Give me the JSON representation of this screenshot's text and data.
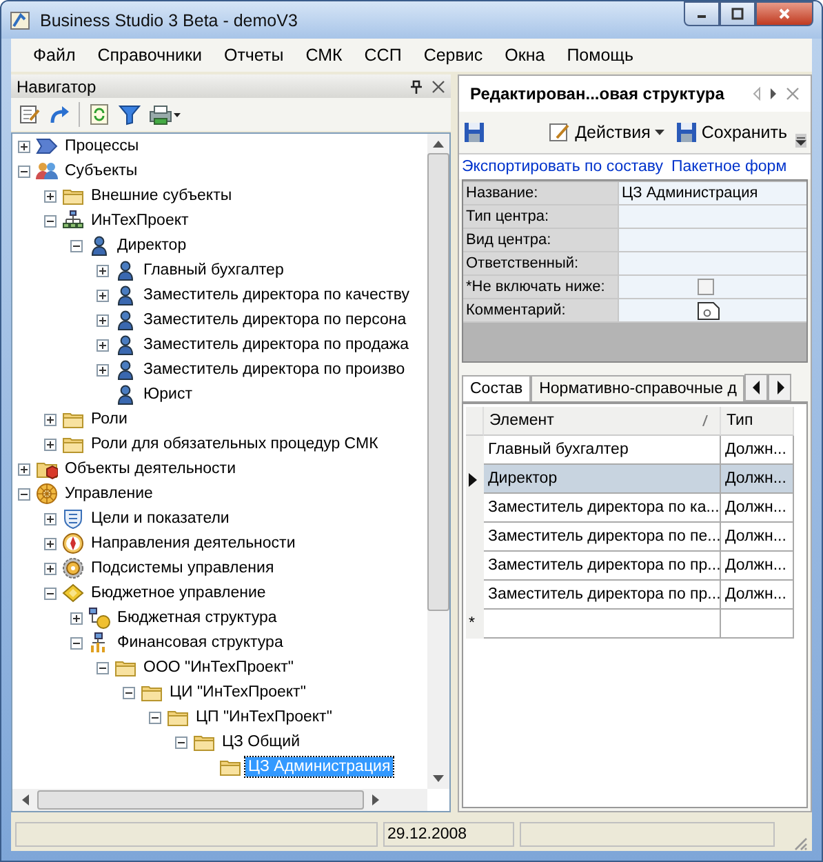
{
  "window": {
    "title": "Business Studio 3 Beta - demoV3"
  },
  "menu": [
    "Файл",
    "Справочники",
    "Отчеты",
    "СМК",
    "ССП",
    "Сервис",
    "Окна",
    "Помощь"
  ],
  "navigator": {
    "title": "Навигатор",
    "tree": [
      {
        "label": "Процессы",
        "kind": "process",
        "expanded": false,
        "selected": false
      },
      {
        "label": "Субъекты",
        "kind": "subjects",
        "expanded": true,
        "selected": false,
        "children": [
          {
            "label": "Внешние субъекты",
            "kind": "folder",
            "expanded": false,
            "selected": false
          },
          {
            "label": "ИнТехПроект",
            "kind": "org",
            "expanded": true,
            "selected": false,
            "children": [
              {
                "label": "Директор",
                "kind": "person",
                "expanded": true,
                "selected": false,
                "children": [
                  {
                    "label": "Главный бухгалтер",
                    "kind": "person",
                    "expanded": false,
                    "selected": false
                  },
                  {
                    "label": "Заместитель директора по качеству",
                    "kind": "person",
                    "expanded": false,
                    "selected": false
                  },
                  {
                    "label": "Заместитель директора по персона",
                    "kind": "person",
                    "expanded": false,
                    "selected": false
                  },
                  {
                    "label": "Заместитель директора по продажа",
                    "kind": "person",
                    "expanded": false,
                    "selected": false
                  },
                  {
                    "label": "Заместитель директора по произво",
                    "kind": "person",
                    "expanded": false,
                    "selected": false
                  },
                  {
                    "label": "Юрист",
                    "kind": "person",
                    "selected": false
                  }
                ]
              }
            ]
          },
          {
            "label": "Роли",
            "kind": "folder",
            "expanded": false,
            "selected": false
          },
          {
            "label": "Роли для обязательных процедур СМК",
            "kind": "folder",
            "expanded": false,
            "selected": false
          }
        ]
      },
      {
        "label": "Объекты деятельности",
        "kind": "objects",
        "expanded": false,
        "selected": false
      },
      {
        "label": "Управление",
        "kind": "management",
        "expanded": true,
        "selected": false,
        "children": [
          {
            "label": "Цели и показатели",
            "kind": "bsc",
            "expanded": false,
            "selected": false
          },
          {
            "label": "Направления деятельности",
            "kind": "compass",
            "expanded": false,
            "selected": false
          },
          {
            "label": "Подсистемы управления",
            "kind": "gear",
            "expanded": false,
            "selected": false
          },
          {
            "label": "Бюджетное управление",
            "kind": "budget",
            "expanded": true,
            "selected": false,
            "children": [
              {
                "label": "Бюджетная структура",
                "kind": "budget-structure",
                "expanded": false,
                "selected": false
              },
              {
                "label": "Финансовая структура",
                "kind": "fin-structure",
                "expanded": true,
                "selected": false,
                "children": [
                  {
                    "label": "ООО \"ИнТехПроект\"",
                    "kind": "folder",
                    "expanded": true,
                    "selected": false,
                    "children": [
                      {
                        "label": "ЦИ \"ИнТехПроект\"",
                        "kind": "folder",
                        "expanded": true,
                        "selected": false,
                        "children": [
                          {
                            "label": "ЦП \"ИнТехПроект\"",
                            "kind": "folder",
                            "expanded": true,
                            "selected": false,
                            "children": [
                              {
                                "label": "ЦЗ Общий",
                                "kind": "folder",
                                "expanded": true,
                                "selected": false,
                                "children": [
                                  {
                                    "label": "ЦЗ Администрация",
                                    "kind": "folder",
                                    "selected": true
                                  }
                                ]
                              }
                            ]
                          }
                        ]
                      }
                    ]
                  }
                ]
              }
            ]
          }
        ]
      }
    ]
  },
  "editor": {
    "title": "Редактирован...овая структура",
    "toolbar": {
      "actions": "Действия",
      "save": "Сохранить"
    },
    "links": [
      "Экспортировать по составу",
      "Пакетное форм"
    ],
    "properties": [
      {
        "label": "Название:",
        "kind": "text",
        "value": "ЦЗ Администрация"
      },
      {
        "label": "Тип центра:",
        "kind": "text"
      },
      {
        "label": "Вид центра:",
        "kind": "text"
      },
      {
        "label": "Ответственный:",
        "kind": "text"
      },
      {
        "label": "*Не включать ниже:",
        "kind": "checkbox",
        "checked": false
      },
      {
        "label": "Комментарий:",
        "kind": "memo"
      }
    ],
    "tabs": [
      {
        "label": "Состав",
        "selected": true
      },
      {
        "label": "Нормативно-справочные д",
        "selected": false
      }
    ],
    "table": {
      "columns": [
        "Элемент",
        "Тип"
      ],
      "rows": [
        {
          "cells": [
            "Главный бухгалтер",
            "Должн..."
          ],
          "selected": false
        },
        {
          "cells": [
            "Директор",
            "Должн..."
          ],
          "selected": true
        },
        {
          "cells": [
            "Заместитель директора по ка...",
            "Должн..."
          ],
          "selected": false
        },
        {
          "cells": [
            "Заместитель директора по пе...",
            "Должн..."
          ],
          "selected": false
        },
        {
          "cells": [
            "Заместитель директора по пр...",
            "Должн..."
          ],
          "selected": false
        },
        {
          "cells": [
            "Заместитель директора по пр...",
            "Должн..."
          ],
          "selected": false
        }
      ],
      "new_row_marker": "*"
    }
  },
  "status_bar": {
    "date": "29.12.2008"
  }
}
